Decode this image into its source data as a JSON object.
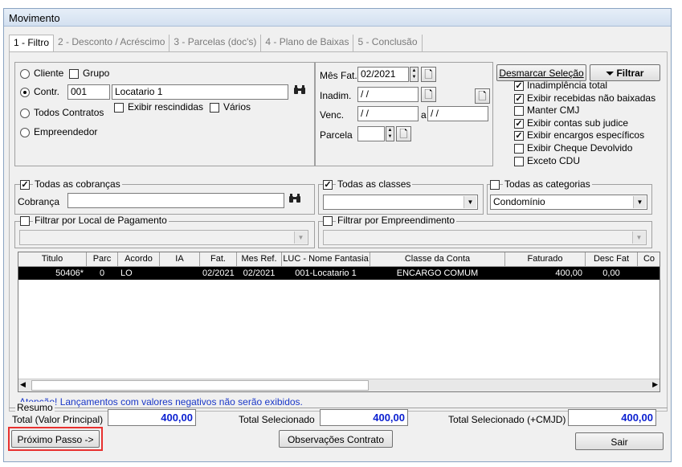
{
  "window": {
    "title": "Movimento"
  },
  "tabs": [
    "1 - Filtro",
    "2 - Desconto / Acréscimo",
    "3 - Parcelas (doc's)",
    "4 - Plano de Baixas",
    "5 - Conclusão"
  ],
  "filter": {
    "cliente_label": "Cliente",
    "grupo_label": "Grupo",
    "contr_label": "Contr.",
    "contr_code": "001",
    "contr_name": "Locatario 1",
    "exibir_rescindidas_label": "Exibir rescindidas",
    "varios_label": "Vários",
    "todos_contratos_label": "Todos Contratos",
    "empreendedor_label": "Empreendedor"
  },
  "dates": {
    "mes_fat_label": "Mês Fat.",
    "mes_fat_value": "02/2021",
    "inadim_label": "Inadim.",
    "inadim_value": " / /",
    "venc_label": "Venc.",
    "venc_from": " / /",
    "venc_sep": "a",
    "venc_to": " / /",
    "parcela_label": "Parcela",
    "parcela_value": ""
  },
  "actions": {
    "desmarcar_label": "Desmarcar Seleção",
    "filtrar_label": "Filtrar"
  },
  "options": [
    {
      "label": "Inadimplência total",
      "checked": true
    },
    {
      "label": "Exibir recebidas não baixadas",
      "checked": true
    },
    {
      "label": "Manter CMJ",
      "checked": false
    },
    {
      "label": "Exibir contas sub judice",
      "checked": true
    },
    {
      "label": "Exibir encargos específicos",
      "checked": true
    },
    {
      "label": "Exibir Cheque Devolvido",
      "checked": false
    },
    {
      "label": "Exceto CDU",
      "checked": false
    }
  ],
  "cobrancas": {
    "label": "Todas as cobranças",
    "field_label": "Cobrança",
    "value": ""
  },
  "classes": {
    "label": "Todas as classes",
    "value": ""
  },
  "categorias": {
    "label": "Todas as categorias",
    "value": "Condomínio"
  },
  "local_pagamento": {
    "label": "Filtrar por Local de Pagamento"
  },
  "empreendimento": {
    "label": "Filtrar por Empreendimento"
  },
  "grid": {
    "columns": [
      "Titulo",
      "Parc",
      "Acordo",
      "IA",
      "Fat.",
      "Mes Ref.",
      "LUC - Nome Fantasia",
      "Classe da Conta",
      "Faturado",
      "Desc Fat",
      "Co"
    ],
    "rows": [
      [
        "50406*",
        "0",
        "LO",
        "",
        "02/2021",
        "02/2021",
        "001-Locatario 1",
        "ENCARGO COMUM",
        "400,00",
        "0,00",
        ""
      ]
    ]
  },
  "warning": "Atenção! Lançamentos com valores negativos não serão exibidos.",
  "resumo": {
    "title": "Resumo",
    "total_principal_label": "Total (Valor Principal)",
    "total_principal": "400,00",
    "total_selecionado_label": "Total Selecionado",
    "total_selecionado": "400,00",
    "total_cmjd_label": "Total Selecionado (+CMJD)",
    "total_cmjd": "400,00"
  },
  "footer": {
    "proximo_label": "Próximo Passo ->",
    "observacoes_label": "Observações Contrato",
    "sair_label": "Sair"
  },
  "colors": {
    "highlight": "#e8312f",
    "total_text": "#0a1fd0",
    "warning_text": "#1a37c8"
  }
}
